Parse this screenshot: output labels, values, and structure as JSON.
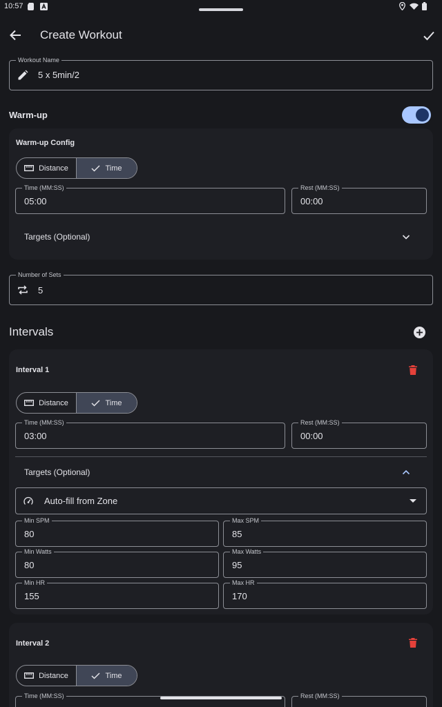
{
  "status_bar": {
    "time": "10:57"
  },
  "app_bar": {
    "title": "Create Workout"
  },
  "workout_name": {
    "label": "Workout Name",
    "value": "5 x 5min/2"
  },
  "warmup": {
    "label": "Warm-up",
    "enabled": true,
    "config_title": "Warm-up Config",
    "segment": {
      "distance": "Distance",
      "time": "Time",
      "selected": "Time"
    },
    "time": {
      "label": "Time (MM:SS)",
      "value": "05:00"
    },
    "rest": {
      "label": "Rest (MM:SS)",
      "value": "00:00"
    },
    "targets_label": "Targets (Optional)"
  },
  "sets": {
    "label": "Number of Sets",
    "value": "5"
  },
  "intervals_header": "Intervals",
  "intervals": [
    {
      "title": "Interval 1",
      "segment": {
        "distance": "Distance",
        "time": "Time",
        "selected": "Time"
      },
      "time": {
        "label": "Time (MM:SS)",
        "value": "03:00"
      },
      "rest": {
        "label": "Rest (MM:SS)",
        "value": "00:00"
      },
      "targets_label": "Targets (Optional)",
      "zone_select": "Auto-fill from Zone",
      "min_spm": {
        "label": "Min SPM",
        "value": "80"
      },
      "max_spm": {
        "label": "Max SPM",
        "value": "85"
      },
      "min_watts": {
        "label": "Min Watts",
        "value": "80"
      },
      "max_watts": {
        "label": "Max Watts",
        "value": "95"
      },
      "min_hr": {
        "label": "Min HR",
        "value": "155"
      },
      "max_hr": {
        "label": "Max HR",
        "value": "170"
      }
    },
    {
      "title": "Interval 2",
      "segment": {
        "distance": "Distance",
        "time": "Time",
        "selected": "Time"
      },
      "time": {
        "label": "Time (MM:SS)",
        "value": ""
      },
      "rest": {
        "label": "Rest (MM:SS)",
        "value": ""
      }
    }
  ],
  "colors": {
    "background": "#18191d",
    "card": "#1e1f24",
    "accent": "#a9c7ff",
    "delete": "#e5413a"
  }
}
